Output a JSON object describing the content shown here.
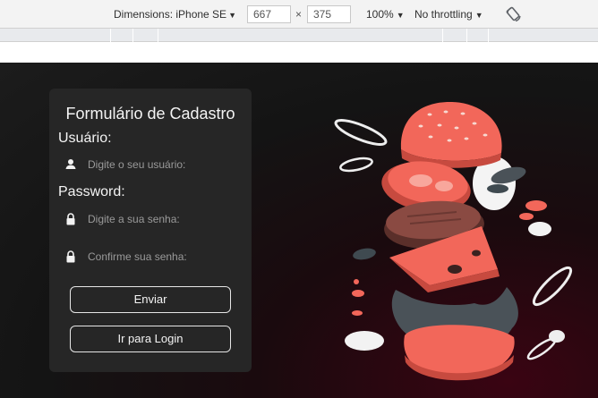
{
  "devtools": {
    "dimensions_label": "Dimensions: iPhone SE",
    "width_value": "667",
    "height_value": "375",
    "times": "×",
    "zoom": "100%",
    "throttling": "No throttling"
  },
  "form": {
    "title": "Formulário de Cadastro",
    "user_label": "Usuário:",
    "user_placeholder": "Digite o seu usuário:",
    "password_label": "Password:",
    "password_placeholder": "Digite a sua senha:",
    "confirm_placeholder": "Confirme sua senha:",
    "submit_label": "Enviar",
    "login_label": "Ir para Login"
  },
  "icons": {
    "user": "user-icon",
    "lock": "lock-icon",
    "rotate": "rotate-icon",
    "illustration": "burger-illustration"
  },
  "colors": {
    "accent": "#f2675a",
    "card": "#262626",
    "background": "#141414"
  }
}
